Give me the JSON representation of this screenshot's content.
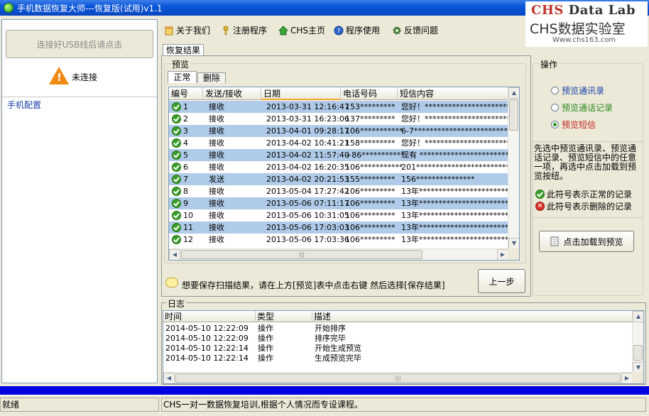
{
  "window": {
    "title": "手机数据恢复大师---恢复版(试用)v1.1"
  },
  "logo": {
    "line1_a": "CHS",
    "line1_b": " Data Lab",
    "line2": "CHS数据实验室",
    "url": "Www.chs163.com"
  },
  "left": {
    "usb_button": "连接好USB线后请点击",
    "status": "未连接",
    "config_label": "手机配置"
  },
  "toolbar": {
    "about": "关于我们",
    "register": "注册程序",
    "home": "CHS主页",
    "usage": "程序使用",
    "feedback": "反馈问题"
  },
  "tabs": {
    "result": "恢复结果",
    "normal": "正常",
    "deleted": "删除"
  },
  "preview": {
    "group_label": "预览",
    "columns": [
      "编号",
      "发送/接收",
      "日期",
      "电话号码",
      "短信内容"
    ],
    "rows": [
      [
        "1",
        "接收",
        "2013-03-31 12:16:47",
        "153*********",
        "您好！****************************"
      ],
      [
        "2",
        "接收",
        "2013-03-31 16:23:06",
        "137*********",
        "您好！****************************"
      ],
      [
        "3",
        "接收",
        "2013-04-01 09:28:17",
        "106***********",
        "6-7**********************************"
      ],
      [
        "4",
        "接收",
        "2013-04-02 10:41:21",
        "158*********",
        "您好！****************************"
      ],
      [
        "5",
        "接收",
        "2013-04-02 11:57:40",
        "+86***********",
        "现有 ***************************"
      ],
      [
        "6",
        "接收",
        "2013-04-02 16:20:35",
        "106***********",
        "201**********************************"
      ],
      [
        "7",
        "发送",
        "2013-04-02 20:21:53",
        "155*********",
        "156***************"
      ],
      [
        "8",
        "接收",
        "2013-05-04 17:27:42",
        "106*********",
        "13年****************************"
      ],
      [
        "9",
        "接收",
        "2013-05-06 07:11:17",
        "106*********",
        "13年****************************"
      ],
      [
        "10",
        "接收",
        "2013-05-06 10:31:05",
        "106*********",
        "13年****************************"
      ],
      [
        "11",
        "接收",
        "2013-05-06 17:03:03",
        "106*********",
        "13年****************************"
      ],
      [
        "12",
        "接收",
        "2013-05-06 17:03:36",
        "106*********",
        "13年****************************"
      ]
    ],
    "selected_rows": [
      1,
      3,
      5,
      7,
      9,
      11
    ],
    "hscroll_thumb_glyph": "|||",
    "vscroll_up_glyph": "▲",
    "vscroll_down_glyph": "▼",
    "hscroll_left_glyph": "◀",
    "hscroll_right_glyph": "▶"
  },
  "hint": "想要保存扫描结果，请在上方[预览]表中点击右键 然后选择[保存结果]",
  "back_button": "上一步",
  "ops": {
    "group_label": "操作",
    "radio_contacts": "预览通讯录",
    "radio_calls": "预览通话记录",
    "radio_sms": "预览短信",
    "selected": "radio_sms",
    "description": "先选中预览通讯录、预览通话记录、预览短信中的任意一项，再选中点击加载到预览按纽。",
    "legend_ok": "此符号表示正常的记录",
    "legend_deleted": "此符号表示删除的记录",
    "load_button": "点击加载到预览"
  },
  "log": {
    "group_label": "日志",
    "columns": [
      "时间",
      "类型",
      "描述"
    ],
    "rows": [
      [
        "2014-05-10 12:22:09",
        "操作",
        "开始排序"
      ],
      [
        "2014-05-10 12:22:09",
        "操作",
        "排序完毕"
      ],
      [
        "2014-05-10 12:22:14",
        "操作",
        "开始生成预览"
      ],
      [
        "2014-05-10 12:22:14",
        "操作",
        "生成预览完毕"
      ]
    ]
  },
  "status": {
    "left": "就绪",
    "right": "CHS一对一数据恢复培训,根据个人情况而专设课程。"
  },
  "colors": {
    "selected_row": "#b0cbe9",
    "title_bar": "#0a55d8",
    "progress_bar": "#0000e0",
    "link_blue": "#1a3fa8"
  }
}
